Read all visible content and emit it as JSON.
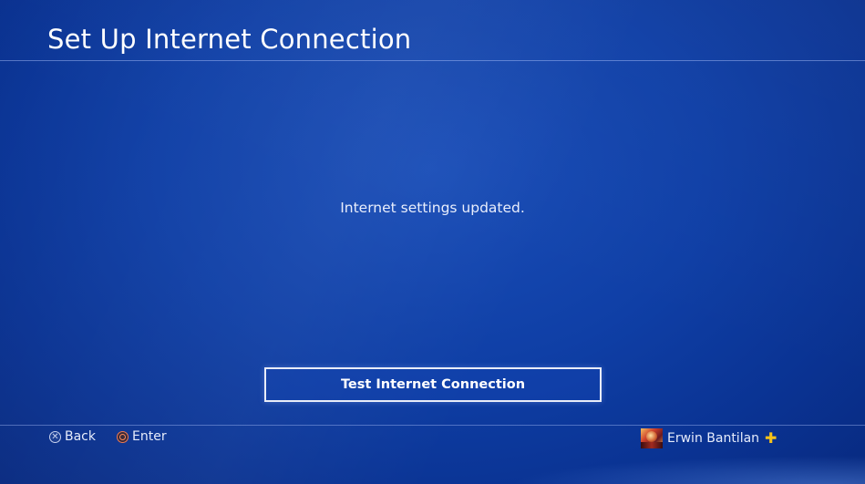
{
  "header": {
    "title": "Set Up Internet Connection"
  },
  "main": {
    "message": "Internet settings updated.",
    "test_button_label": "Test Internet Connection"
  },
  "footer": {
    "back": {
      "icon": "cross-button-icon",
      "label": "Back"
    },
    "enter": {
      "icon": "circle-button-icon",
      "label": "Enter"
    },
    "user": {
      "name": "Erwin Bantilan",
      "plus_icon": "playstation-plus-icon",
      "plus_color": "#f6c21a"
    }
  },
  "colors": {
    "background": "#0f3fa6",
    "text": "#ffffff"
  }
}
